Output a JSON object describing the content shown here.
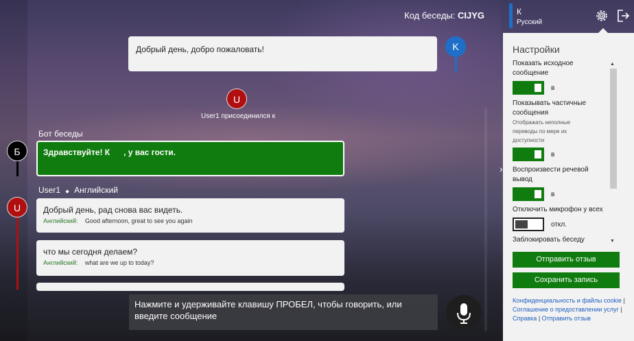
{
  "header": {
    "conversation_code_label": "Код беседы:",
    "conversation_code": "CIJYG"
  },
  "user_card": {
    "initial": "К",
    "language": "Русский"
  },
  "messages": {
    "host_greeting": {
      "avatar": "K",
      "text": "Добрый день, добро пожаловать!"
    },
    "join_notice": {
      "avatar": "U",
      "text": "User1 присоединился к"
    },
    "bot": {
      "avatar": "Б",
      "speaker": "Бот беседы",
      "text": "Здравствуйте! К      , у вас гости."
    },
    "user1_header": {
      "speaker": "User1",
      "separator": "◆",
      "language": "Английский"
    },
    "user1_avatar": "U",
    "user1_msgs": [
      {
        "text": "Добрый день, рад снова вас видеть.",
        "lang": "Английский:",
        "translation": "Good afternoon, great to see you again"
      },
      {
        "text": "что мы сегодня делаем?",
        "lang": "Английский:",
        "translation": "what are we up to today?"
      }
    ]
  },
  "input": {
    "placeholder": "Нажмите и удерживайте клавишу ПРОБЕЛ, чтобы говорить, или введите сообщение"
  },
  "settings": {
    "title": "Настройки",
    "items": [
      {
        "label": "Показать исходное сообщение",
        "desc": "",
        "state": "в",
        "on": true
      },
      {
        "label": "Показывать частичные сообщения",
        "desc": "Отображать неполные переводы по мере их доступности",
        "state": "в",
        "on": true
      },
      {
        "label": "Воспроизвести речевой вывод",
        "desc": "",
        "state": "в",
        "on": true
      },
      {
        "label": "Отключить микрофон у всех",
        "desc": "",
        "state": "откл.",
        "on": false
      }
    ],
    "next_item_partial": "Заблокировать беседу",
    "send_feedback": "Отправить отзыв",
    "save_record": "Сохранить запись",
    "links": {
      "privacy": "Конфиденциальность и файлы cookie",
      "sep1": " | ",
      "terms": "Соглашение о предоставлении услуг",
      "sep2": " | ",
      "help": "Справка",
      "sep3": " | ",
      "feedback": "Отправить отзыв"
    }
  },
  "colors": {
    "accent_green": "#107c10",
    "user_blue": "#1f6fc8",
    "user_red": "#b10f0f"
  }
}
